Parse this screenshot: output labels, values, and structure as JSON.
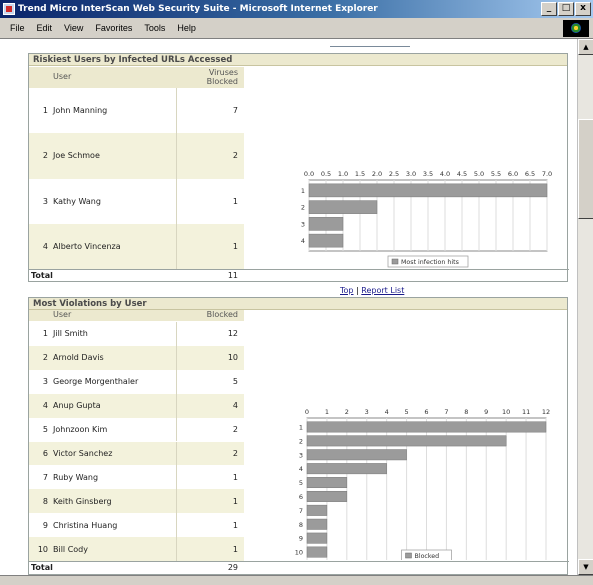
{
  "window": {
    "title": "Trend Micro InterScan Web Security Suite - Microsoft Internet Explorer",
    "minimize": "_",
    "maximize": "□",
    "close": "x"
  },
  "menu": [
    "File",
    "Edit",
    "View",
    "Favorites",
    "Tools",
    "Help"
  ],
  "report1": {
    "title": "Riskiest Users by Infected URLs Accessed",
    "col_user": "User",
    "col_value": "Viruses Blocked",
    "rows": [
      {
        "idx": "1",
        "name": "John Manning",
        "value": "7"
      },
      {
        "idx": "2",
        "name": "Joe Schmoe",
        "value": "2"
      },
      {
        "idx": "3",
        "name": "Kathy Wang",
        "value": "1"
      },
      {
        "idx": "4",
        "name": "Alberto Vincenza",
        "value": "1"
      }
    ],
    "total_label": "Total",
    "total_value": "11"
  },
  "links": {
    "top": "Top",
    "separator": "|",
    "report_list": "Report List"
  },
  "report2": {
    "title": "Most Violations by User",
    "col_user": "User",
    "col_value": "Blocked",
    "rows": [
      {
        "idx": "1",
        "name": "Jill Smith",
        "value": "12"
      },
      {
        "idx": "2",
        "name": "Arnold Davis",
        "value": "10"
      },
      {
        "idx": "3",
        "name": "George Morgenthaler",
        "value": "5"
      },
      {
        "idx": "4",
        "name": "Anup Gupta",
        "value": "4"
      },
      {
        "idx": "5",
        "name": "Johnzoon Kim",
        "value": "2"
      },
      {
        "idx": "6",
        "name": "Victor Sanchez",
        "value": "2"
      },
      {
        "idx": "7",
        "name": "Ruby Wang",
        "value": "1"
      },
      {
        "idx": "8",
        "name": "Keith Ginsberg",
        "value": "1"
      },
      {
        "idx": "9",
        "name": "Christina Huang",
        "value": "1"
      },
      {
        "idx": "10",
        "name": "Bill Cody",
        "value": "1"
      }
    ],
    "total_label": "Total",
    "total_value": "29"
  },
  "colors": {
    "bar": "#9b9b9b",
    "header_bg": "#ece9cf",
    "alt_row": "#f3f2dc",
    "title_bar": "#0a246a"
  },
  "chart_data": [
    {
      "type": "bar",
      "orientation": "horizontal",
      "categories": [
        "1",
        "2",
        "3",
        "4"
      ],
      "series": [
        {
          "name": "Most infection hits",
          "values": [
            7,
            2,
            1,
            1
          ]
        }
      ],
      "xlim": [
        0,
        7
      ],
      "tick_labels": [
        "0.0",
        "0.5",
        "1.0",
        "1.5",
        "2.0",
        "2.5",
        "3.0",
        "3.5",
        "4.0",
        "4.5",
        "5.0",
        "5.5",
        "6.0",
        "6.5",
        "7.0"
      ],
      "grid": true,
      "legend": "bottom"
    },
    {
      "type": "bar",
      "orientation": "horizontal",
      "categories": [
        "1",
        "2",
        "3",
        "4",
        "5",
        "6",
        "7",
        "8",
        "9",
        "10"
      ],
      "series": [
        {
          "name": "Blocked",
          "values": [
            12,
            10,
            5,
            4,
            2,
            2,
            1,
            1,
            1,
            1
          ]
        }
      ],
      "xlim": [
        0,
        12
      ],
      "tick_labels": [
        "0",
        "1",
        "2",
        "3",
        "4",
        "5",
        "6",
        "7",
        "8",
        "9",
        "10",
        "11",
        "12"
      ],
      "grid": true,
      "legend": "bottom"
    }
  ]
}
